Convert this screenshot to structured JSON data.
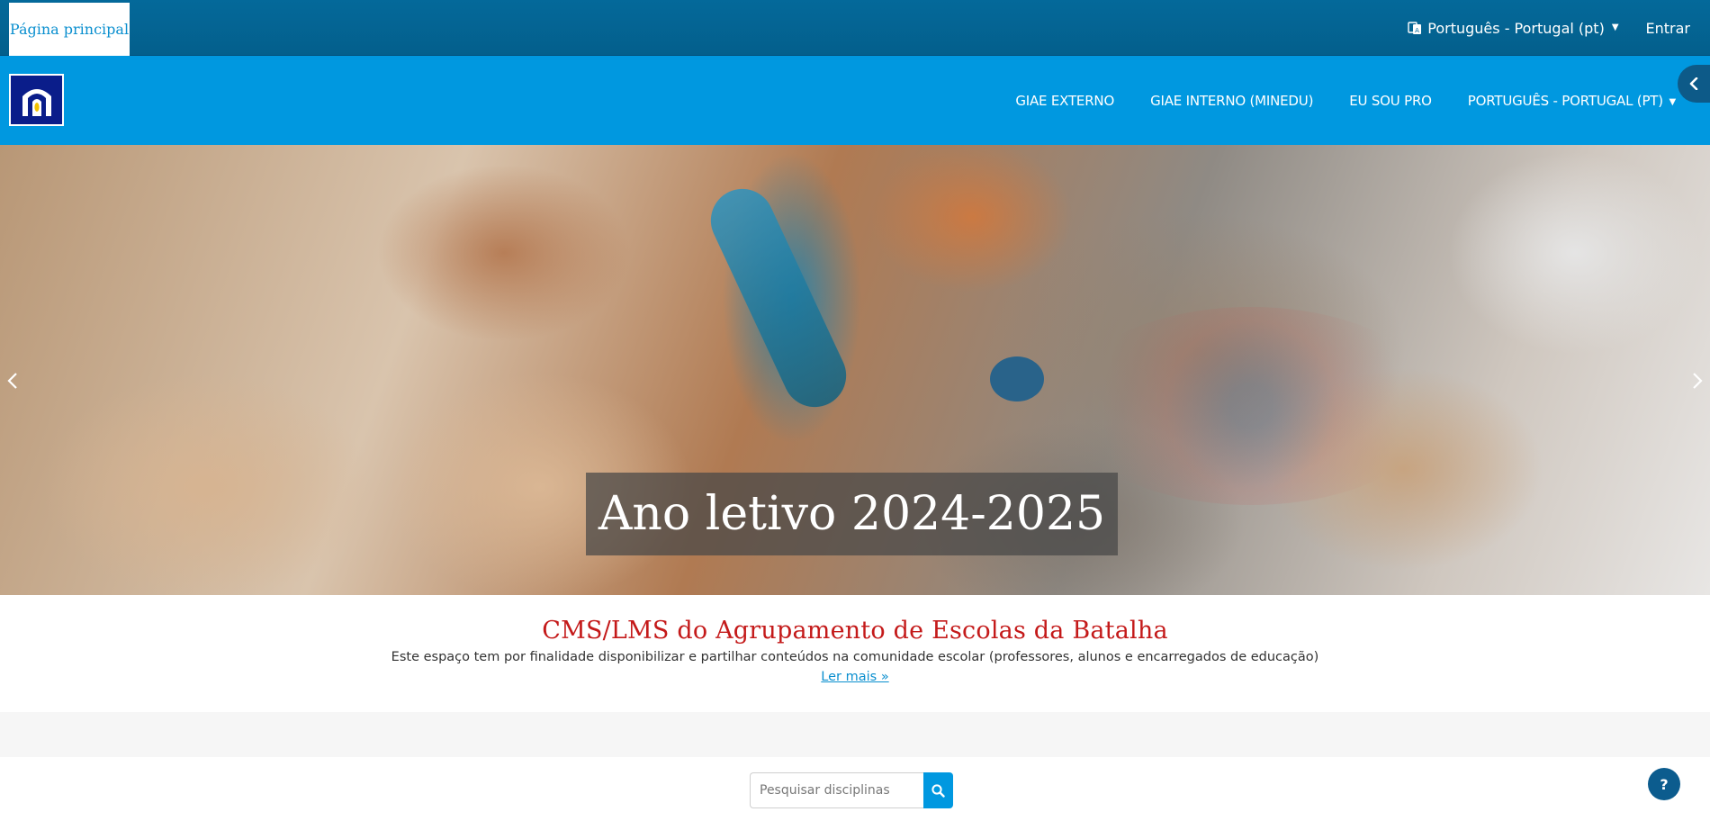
{
  "topbar": {
    "home_label": "Página principal",
    "language_label": "Português - Portugal (pt)",
    "login_label": "Entrar"
  },
  "navbar": {
    "logo": "school-logo",
    "links": [
      {
        "label": "GIAE EXTERNO"
      },
      {
        "label": "GIAE INTERNO (MINEDU)"
      },
      {
        "label": "EU SOU PRO"
      },
      {
        "label": "PORTUGUÊS - PORTUGAL (PT)"
      }
    ]
  },
  "hero": {
    "caption": "Ano letivo 2024-2025"
  },
  "intro": {
    "title": "CMS/LMS do Agrupamento de Escolas da Batalha",
    "text": "Este espaço tem por finalidade disponibilizar e partilhar conteúdos na comunidade escolar (professores, alunos e encarregados de educação)",
    "more_label": "Ler mais »"
  },
  "search": {
    "placeholder": "Pesquisar disciplinas"
  },
  "help": {
    "label": "?"
  },
  "colors": {
    "topbar": "#04699a",
    "navbar": "#0098e0",
    "title_red": "#c41a1a",
    "link_blue": "#0a8fcf"
  }
}
